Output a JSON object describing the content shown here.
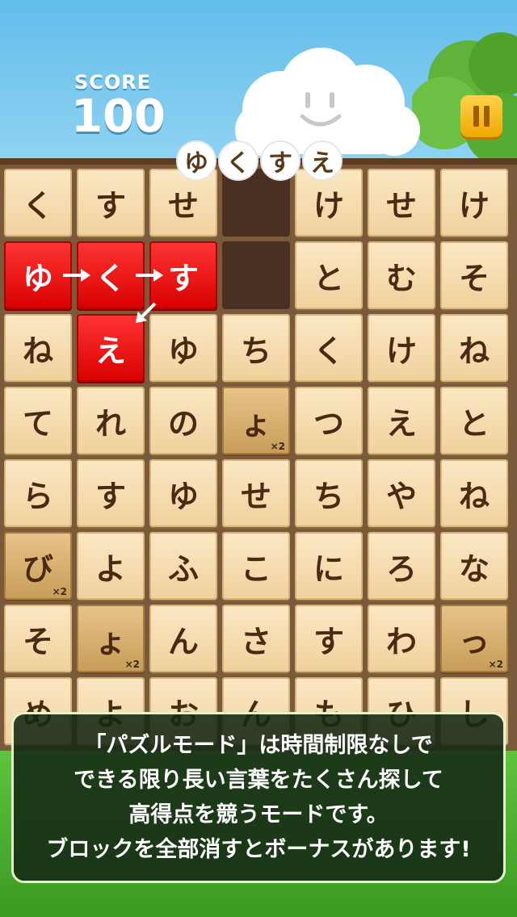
{
  "score": {
    "label": "SCORE",
    "value": "100"
  },
  "current_word": [
    "ゆ",
    "く",
    "す",
    "え"
  ],
  "board": {
    "rows": [
      [
        "く",
        "す",
        "せ",
        "",
        "け",
        "せ",
        "け"
      ],
      [
        "ゆ",
        "く",
        "す",
        "",
        "と",
        "む",
        "そ"
      ],
      [
        "ね",
        "え",
        "ゆ",
        "ち",
        "く",
        "け",
        "ね"
      ],
      [
        "て",
        "れ",
        "の",
        "ょ",
        "つ",
        "え",
        "と"
      ],
      [
        "ら",
        "す",
        "ゆ",
        "せ",
        "ち",
        "や",
        "ね"
      ],
      [
        "び",
        "よ",
        "ふ",
        "こ",
        "に",
        "ろ",
        "な"
      ],
      [
        "そ",
        "ょ",
        "ん",
        "さ",
        "す",
        "わ",
        "っ"
      ],
      [
        "め",
        "よ",
        "お",
        "ん",
        "も",
        "ひ",
        "し"
      ]
    ],
    "selected": [
      [
        1,
        0
      ],
      [
        1,
        1
      ],
      [
        1,
        2
      ],
      [
        2,
        1
      ]
    ],
    "bonus_tiles": [
      {
        "row": 3,
        "col": 3,
        "multiplier": "×2"
      },
      {
        "row": 5,
        "col": 0,
        "multiplier": "×2"
      },
      {
        "row": 6,
        "col": 1,
        "multiplier": "×2"
      },
      {
        "row": 6,
        "col": 6,
        "multiplier": "×2"
      }
    ]
  },
  "message": {
    "lines": [
      "「パズルモード」は時間制限なしで",
      "できる限り長い言葉をたくさん探して",
      "高得点を競うモードです。",
      "ブロックを全部消すとボーナスがあります!"
    ]
  },
  "icons": {
    "pause": "pause-icon",
    "mascot": "cloud-mascot-icon"
  },
  "colors": {
    "selected": "#e00000",
    "tile": "#f5dcae",
    "bonus_tile": "#d4a968",
    "sky": "#7ec9ef"
  }
}
